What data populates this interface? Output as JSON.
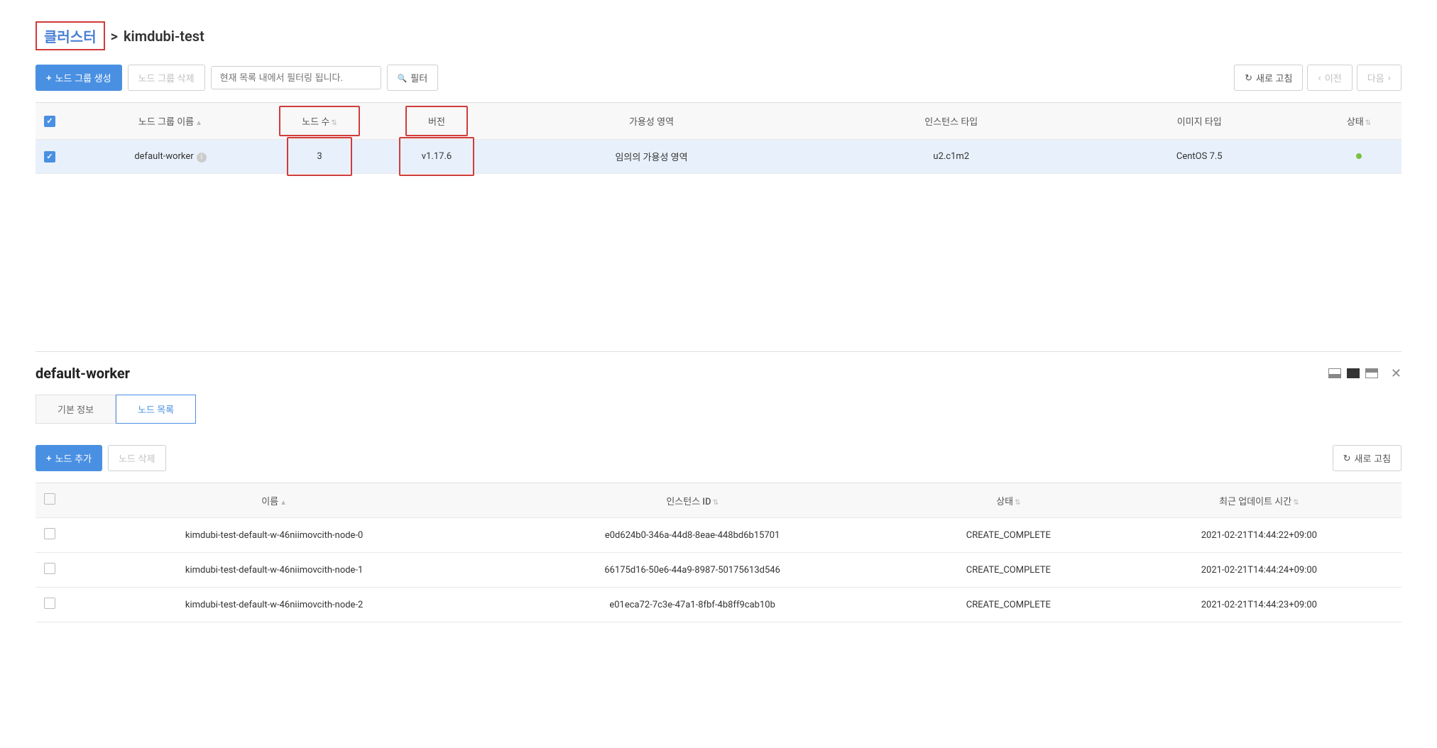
{
  "breadcrumb": {
    "root": "클러스터",
    "sep": ">",
    "current": "kimdubi-test"
  },
  "toolbar": {
    "create_group": "노드 그룹 생성",
    "delete_group": "노드 그룹 삭제",
    "filter_placeholder": "현재 목록 내에서 필터링 됩니다.",
    "filter_btn": "필터",
    "refresh": "새로 고침",
    "prev": "이전",
    "next": "다음"
  },
  "table1": {
    "headers": {
      "name": "노드 그룹 이름",
      "count": "노드 수",
      "version": "버전",
      "az": "가용성 영역",
      "instance": "인스턴스 타입",
      "image": "이미지 타입",
      "status": "상태"
    },
    "row": {
      "name": "default-worker",
      "count": "3",
      "version": "v1.17.6",
      "az": "임의의 가용성 영역",
      "instance": "u2.c1m2",
      "image": "CentOS 7.5"
    }
  },
  "panel": {
    "title": "default-worker",
    "tabs": {
      "basic": "기본 정보",
      "nodes": "노드 목록"
    },
    "add_node": "노드 추가",
    "delete_node": "노드 삭제",
    "refresh": "새로 고침"
  },
  "table2": {
    "headers": {
      "name": "이름",
      "instance_id": "인스턴스 ID",
      "status": "상태",
      "updated": "최근 업데이트 시간"
    },
    "rows": [
      {
        "name": "kimdubi-test-default-w-46niimovcith-node-0",
        "instance_id": "e0d624b0-346a-44d8-8eae-448bd6b15701",
        "status": "CREATE_COMPLETE",
        "updated": "2021-02-21T14:44:22+09:00"
      },
      {
        "name": "kimdubi-test-default-w-46niimovcith-node-1",
        "instance_id": "66175d16-50e6-44a9-8987-50175613d546",
        "status": "CREATE_COMPLETE",
        "updated": "2021-02-21T14:44:24+09:00"
      },
      {
        "name": "kimdubi-test-default-w-46niimovcith-node-2",
        "instance_id": "e01eca72-7c3e-47a1-8fbf-4b8ff9cab10b",
        "status": "CREATE_COMPLETE",
        "updated": "2021-02-21T14:44:23+09:00"
      }
    ]
  }
}
